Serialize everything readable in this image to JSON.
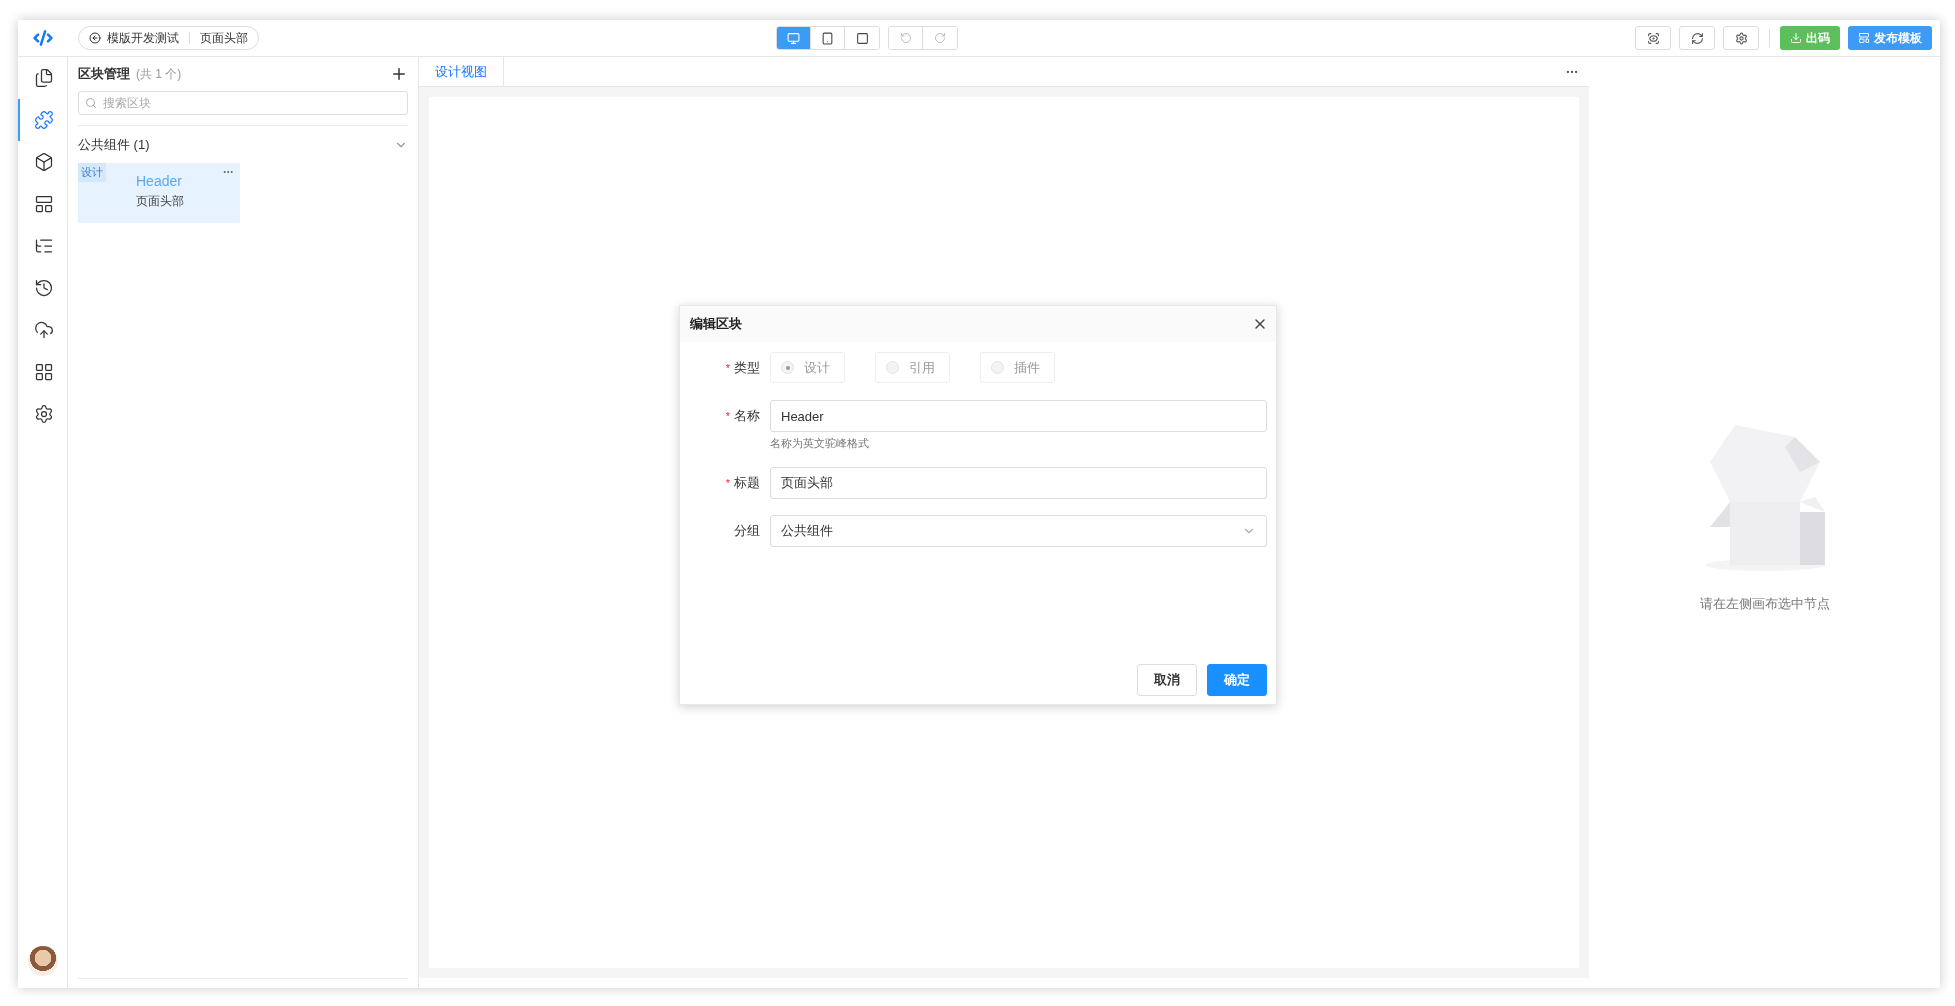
{
  "toolbar": {
    "breadcrumb": [
      "模版开发测试",
      "页面头部"
    ],
    "devices": [
      {
        "kind": "desktop",
        "selected": true
      },
      {
        "kind": "tablet",
        "selected": false
      },
      {
        "kind": "screen",
        "selected": false
      }
    ],
    "history": [
      {
        "kind": "undo",
        "disabled": true
      },
      {
        "kind": "redo",
        "disabled": true
      }
    ],
    "tools": [
      {
        "kind": "preview"
      },
      {
        "kind": "refresh"
      },
      {
        "kind": "settings"
      }
    ],
    "actions": [
      {
        "label": "出码",
        "kind": "download"
      },
      {
        "label": "发布模板",
        "kind": "publish"
      }
    ]
  },
  "activity_bar": [
    {
      "kind": "pages",
      "selected": false
    },
    {
      "kind": "blocks",
      "selected": true
    },
    {
      "kind": "materials",
      "selected": false
    },
    {
      "kind": "layout",
      "selected": false
    },
    {
      "kind": "tree",
      "selected": false
    },
    {
      "kind": "history",
      "selected": false
    },
    {
      "kind": "api",
      "selected": false
    },
    {
      "kind": "apps",
      "selected": false
    },
    {
      "kind": "settings",
      "selected": false
    }
  ],
  "block_panel": {
    "title": "区块管理",
    "count": "(共 1 个)",
    "search_placeholder": "搜索区块",
    "groups": [
      {
        "name": "公共组件 (1)",
        "expanded": true,
        "blocks": [
          {
            "tag": "设计",
            "name": "Header",
            "title": "页面头部",
            "selected": true
          }
        ]
      }
    ]
  },
  "canvas": {
    "tabs": [
      {
        "label": "设计视图",
        "selected": true
      }
    ]
  },
  "dialog": {
    "title": "编辑区块",
    "fields": [
      {
        "kind": "radio",
        "label": "类型",
        "required_mark": "*",
        "options": [
          {
            "label": "设计",
            "selected": true,
            "disabled": true
          },
          {
            "label": "引用",
            "selected": false,
            "disabled": true
          },
          {
            "label": "插件",
            "selected": false,
            "disabled": true
          }
        ]
      },
      {
        "kind": "input",
        "label": "名称",
        "required_mark": "*",
        "value": "Header",
        "hint": "名称为英文驼峰格式"
      },
      {
        "kind": "input",
        "label": "标题",
        "required_mark": "*",
        "value": "页面头部"
      },
      {
        "kind": "select",
        "label": "分组",
        "value": "公共组件"
      }
    ],
    "buttons": [
      {
        "label": "取消",
        "kind": "default"
      },
      {
        "label": "确定",
        "kind": "primary"
      }
    ]
  },
  "properties": {
    "empty_text": "请在左侧画布选中节点"
  }
}
